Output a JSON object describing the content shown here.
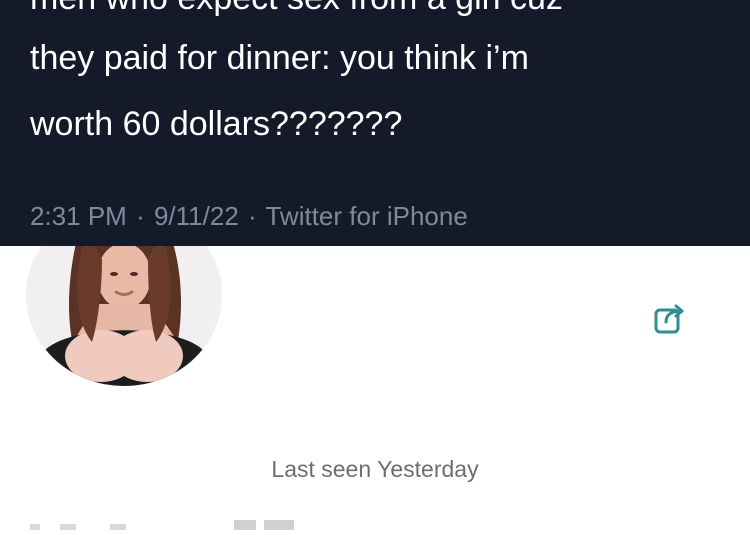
{
  "tweet": {
    "lines": [
      "men who expect sex from a girl cuz",
      "they paid for dinner: you think i’m",
      "worth 60 dollars???????"
    ],
    "time": "2:31 PM",
    "date": "9/11/22",
    "source": "Twitter for iPhone",
    "separator": "·"
  },
  "profile": {
    "avatar_icon": "profile-photo",
    "share_icon": "share-icon",
    "last_seen": "Last seen Yesterday"
  },
  "colors": {
    "tweet_bg": "#151a2b",
    "tweet_text": "#ffffff",
    "meta_text": "#7f8a99",
    "accent": "#2f8f95",
    "muted": "#6e6e6e"
  }
}
